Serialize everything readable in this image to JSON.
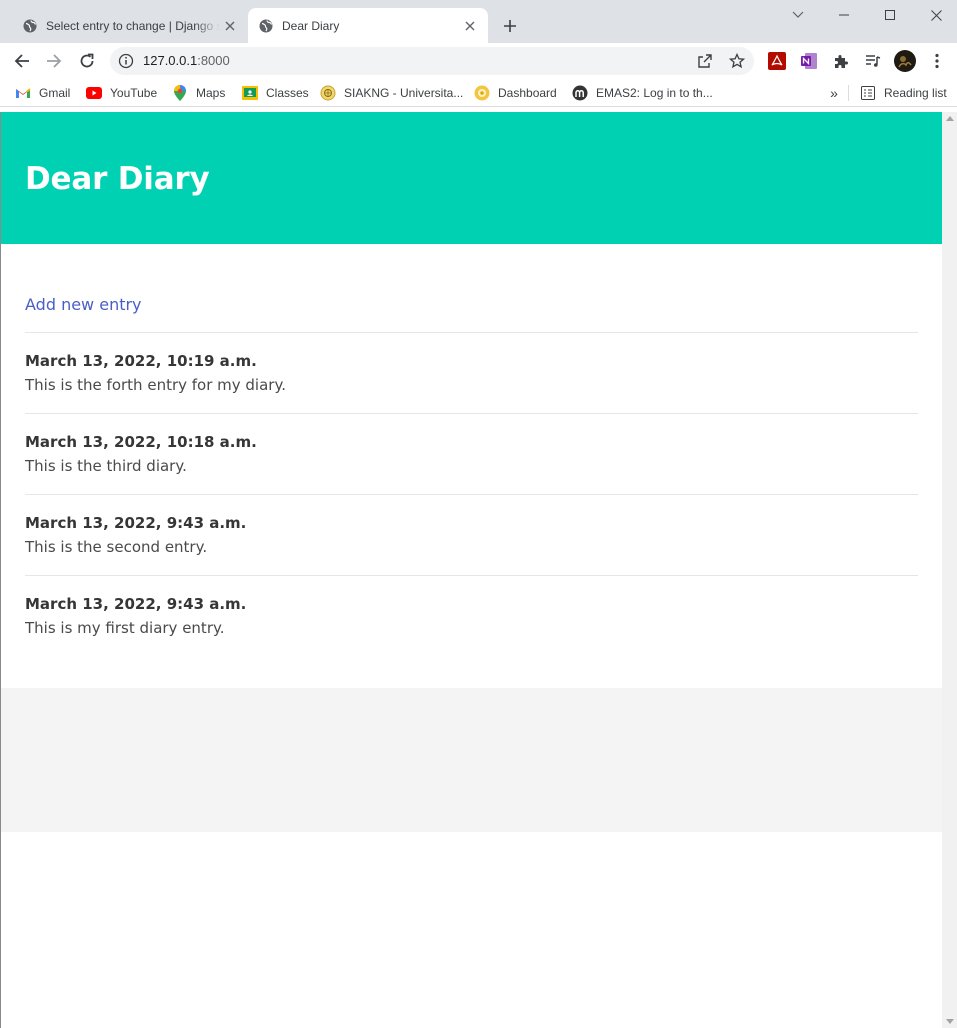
{
  "browser": {
    "tabs": [
      {
        "title": "Select entry to change | Django site admin",
        "active": false
      },
      {
        "title": "Dear Diary",
        "active": true
      }
    ],
    "url_host": "127.0.0.1",
    "url_port": ":8000",
    "bookmarks": [
      {
        "label": "Gmail",
        "icon": "gmail-icon"
      },
      {
        "label": "YouTube",
        "icon": "youtube-icon"
      },
      {
        "label": "Maps",
        "icon": "maps-icon"
      },
      {
        "label": "Classes",
        "icon": "classroom-icon"
      },
      {
        "label": "SIAKNG - Universita...",
        "icon": "university-icon"
      },
      {
        "label": "Dashboard",
        "icon": "dashboard-icon"
      },
      {
        "label": "EMAS2: Log in to th...",
        "icon": "moodle-icon"
      }
    ],
    "more_bookmarks": "»",
    "reading_list": "Reading list"
  },
  "page": {
    "title": "Dear Diary",
    "add_link": "Add new entry",
    "entries": [
      {
        "date": "March 13, 2022, 10:19 a.m.",
        "text": "This is the forth entry for my diary."
      },
      {
        "date": "March 13, 2022, 10:18 a.m.",
        "text": "This is the third diary."
      },
      {
        "date": "March 13, 2022, 9:43 a.m.",
        "text": "This is the second entry."
      },
      {
        "date": "March 13, 2022, 9:43 a.m.",
        "text": "This is my first diary entry."
      }
    ]
  },
  "colors": {
    "hero": "#00d1b2",
    "link": "#485fc7",
    "footer": "#f4f4f4"
  }
}
